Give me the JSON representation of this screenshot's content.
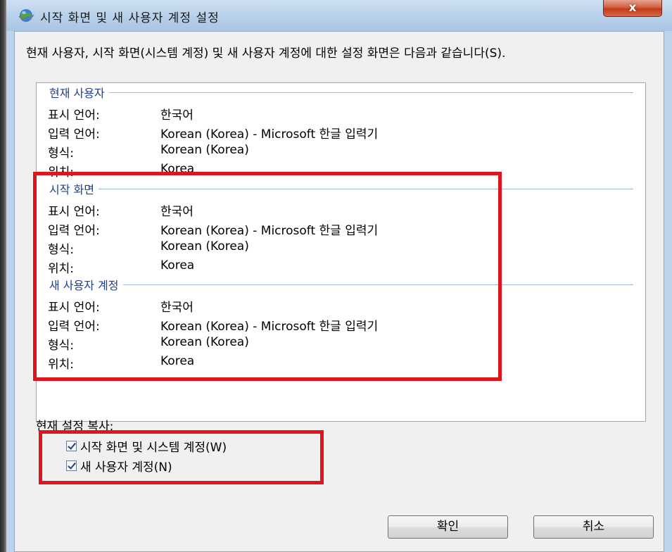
{
  "window": {
    "title": "시작 화면 및 새 사용자 계정 설정",
    "close_label": "x"
  },
  "intro_text": "현재 사용자, 시작 화면(시스템 계정) 및 새 사용자 계정에 대한 설정 화면은 다음과 같습니다(S).",
  "groups": [
    {
      "title": "현재 사용자",
      "rows": [
        {
          "key": "표시 언어:",
          "value": "한국어"
        },
        {
          "key": "입력 언어:",
          "value": "Korean (Korea) - Microsoft 한글 입력기"
        },
        {
          "key": "형식:",
          "value": "Korean (Korea)"
        },
        {
          "key": "위치:",
          "value": "Korea"
        }
      ]
    },
    {
      "title": "시작 화면",
      "rows": [
        {
          "key": "표시 언어:",
          "value": "한국어"
        },
        {
          "key": "입력 언어:",
          "value": "Korean (Korea) - Microsoft 한글 입력기"
        },
        {
          "key": "형식:",
          "value": "Korean (Korea)"
        },
        {
          "key": "위치:",
          "value": "Korea"
        }
      ]
    },
    {
      "title": "새 사용자 계정",
      "rows": [
        {
          "key": "표시 언어:",
          "value": "한국어"
        },
        {
          "key": "입력 언어:",
          "value": "Korean (Korea) - Microsoft 한글 입력기"
        },
        {
          "key": "형식:",
          "value": "Korean (Korea)"
        },
        {
          "key": "위치:",
          "value": "Korea"
        }
      ]
    }
  ],
  "copy_settings": {
    "label": "현재 설정 복사:",
    "welcome_checkbox": {
      "label": "시작 화면 및 시스템 계정(W)",
      "checked": true
    },
    "new_user_checkbox": {
      "label": "새 사용자 계정(N)",
      "checked": true
    }
  },
  "buttons": {
    "ok": "확인",
    "cancel": "취소"
  },
  "highlight_color": "#e0141c"
}
